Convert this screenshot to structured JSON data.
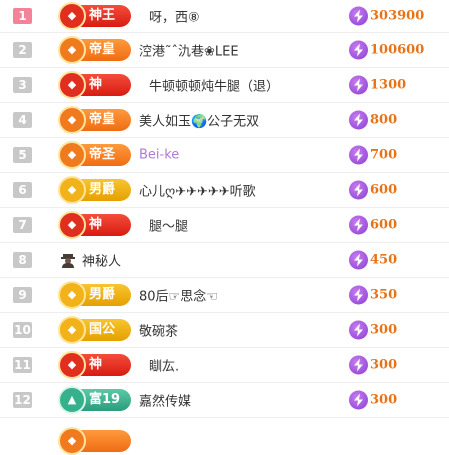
{
  "rows": [
    {
      "rank": "1",
      "badge": "神王",
      "style": "red",
      "name": "呀，西⑧",
      "value": "303900"
    },
    {
      "rank": "2",
      "badge": "帝皇",
      "style": "orange",
      "name": "涳港˜ˆ氿巷❀LEE",
      "value": "100600"
    },
    {
      "rank": "3",
      "badge": "神",
      "style": "red",
      "name": "牛顿顿顿炖牛腿（退）",
      "value": "1300"
    },
    {
      "rank": "4",
      "badge": "帝皇",
      "style": "orange",
      "name": "美人如玉🌍公子无双",
      "value": "800"
    },
    {
      "rank": "5",
      "badge": "帝圣",
      "style": "orange",
      "name": "Bei-ke",
      "value": "700"
    },
    {
      "rank": "6",
      "badge": "男爵",
      "style": "gold",
      "name": "心儿ღ✈✈✈✈✈听歌",
      "value": "600"
    },
    {
      "rank": "7",
      "badge": "神",
      "style": "red",
      "name": "腿～腿",
      "value": "600"
    },
    {
      "rank": "8",
      "badge": "",
      "style": "mystery",
      "name": "神秘人",
      "value": "450"
    },
    {
      "rank": "9",
      "badge": "男爵",
      "style": "gold",
      "name": "80后☞思念☜",
      "value": "350"
    },
    {
      "rank": "10",
      "badge": "国公",
      "style": "gold",
      "name": "敬碗茶",
      "value": "300"
    },
    {
      "rank": "11",
      "badge": "神",
      "style": "red",
      "name": "瞓厷.",
      "value": "300"
    },
    {
      "rank": "12",
      "badge": "富19",
      "style": "teal",
      "name": "嘉然传媒",
      "value": "300"
    }
  ],
  "colors": {
    "rank_top": "#f4839a",
    "rank_default": "#c8c8c8",
    "value": "#e87317",
    "name_special": "#b07ad9"
  },
  "icons": {
    "value": "lightning-bolt-icon",
    "mystery": "mystery-person-icon",
    "badge": "noble-emblem-icon"
  }
}
